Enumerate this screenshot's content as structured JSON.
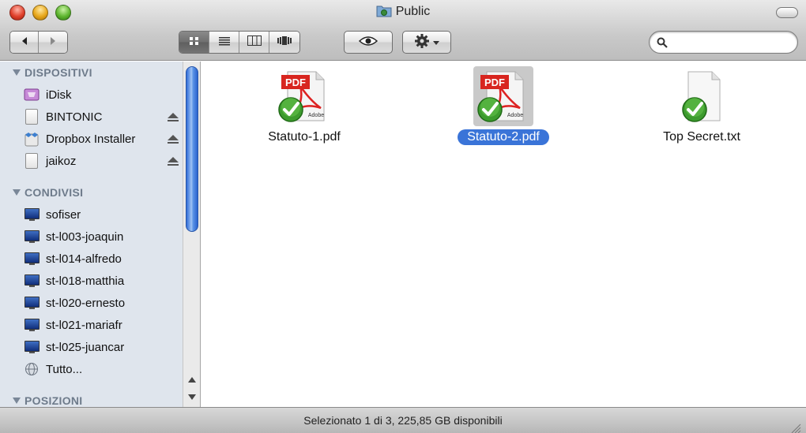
{
  "window": {
    "title": "Public",
    "title_icon": "public-folder-icon"
  },
  "toolbar": {
    "back_icon": "back-arrow-icon",
    "forward_icon": "forward-arrow-icon",
    "views": [
      "icon-view-icon",
      "list-view-icon",
      "column-view-icon",
      "coverflow-view-icon"
    ],
    "active_view": "icon-view-icon",
    "quicklook_icon": "eye-icon",
    "action_icon": "gear-icon",
    "search_placeholder": ""
  },
  "sidebar": {
    "sections": [
      {
        "header": "DISPOSITIVI",
        "items": [
          {
            "label": "iDisk",
            "icon": "idisk-icon",
            "eject": false
          },
          {
            "label": "BINTONIC",
            "icon": "disk-icon",
            "eject": true
          },
          {
            "label": "Dropbox Installer",
            "icon": "dropbox-installer-icon",
            "eject": true
          },
          {
            "label": "jaikoz",
            "icon": "disk-icon",
            "eject": true
          }
        ]
      },
      {
        "header": "CONDIVISI",
        "items": [
          {
            "label": "sofiser",
            "icon": "monitor-icon"
          },
          {
            "label": "st-l003-joaquin",
            "icon": "monitor-icon"
          },
          {
            "label": "st-l014-alfredo",
            "icon": "monitor-icon"
          },
          {
            "label": "st-l018-matthia",
            "icon": "monitor-icon"
          },
          {
            "label": "st-l020-ernesto",
            "icon": "monitor-icon"
          },
          {
            "label": "st-l021-mariafr",
            "icon": "monitor-icon"
          },
          {
            "label": "st-l025-juancar",
            "icon": "monitor-icon"
          },
          {
            "label": "Tutto...",
            "icon": "network-globe-icon"
          }
        ]
      },
      {
        "header": "POSIZIONI",
        "items": []
      }
    ]
  },
  "files": [
    {
      "name": "Statuto-1.pdf",
      "type": "pdf",
      "selected": false,
      "badge": "checkmark-badge-icon",
      "pdf_label": "PDF",
      "adobe_label": "Adobe"
    },
    {
      "name": "Statuto-2.pdf",
      "type": "pdf",
      "selected": true,
      "badge": "checkmark-badge-icon",
      "pdf_label": "PDF",
      "adobe_label": "Adobe"
    },
    {
      "name": "Top Secret.txt",
      "type": "txt",
      "selected": false,
      "badge": "checkmark-badge-icon"
    }
  ],
  "status": {
    "text": "Selezionato 1 di 3, 225,85 GB disponibili"
  },
  "colors": {
    "selection": "#3a74d8",
    "sidebar_bg": "#dfe5ed",
    "section_header": "#6e7b8b"
  }
}
